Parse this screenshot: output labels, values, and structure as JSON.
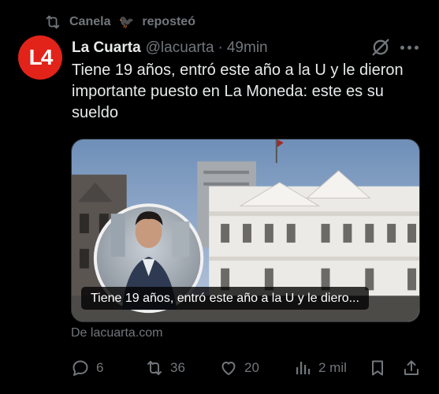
{
  "repost": {
    "user": "Canela",
    "emoji": "🐦‍⬛",
    "label": "reposteó"
  },
  "author": {
    "avatar_text": "L4",
    "name": "La Cuarta",
    "handle": "@lacuarta",
    "separator": "·",
    "time": "49min"
  },
  "tweet": {
    "text": "Tiene 19 años, entró este año a la U y le dieron importante puesto en La Moneda: este es su sueldo",
    "media_caption": "Tiene 19 años, entró este año a la U y le diero...",
    "source": "De lacuarta.com"
  },
  "actions": {
    "replies": "6",
    "reposts": "36",
    "likes": "20",
    "views": "2 mil"
  },
  "icons": [
    "repost-icon",
    "grok-icon",
    "more-icon",
    "reply-icon",
    "like-icon",
    "views-icon",
    "bookmark-icon",
    "share-icon"
  ],
  "colors": {
    "background": "#000000",
    "text": "#e7e9ea",
    "muted": "#71767b",
    "brand": "#e2231a"
  }
}
